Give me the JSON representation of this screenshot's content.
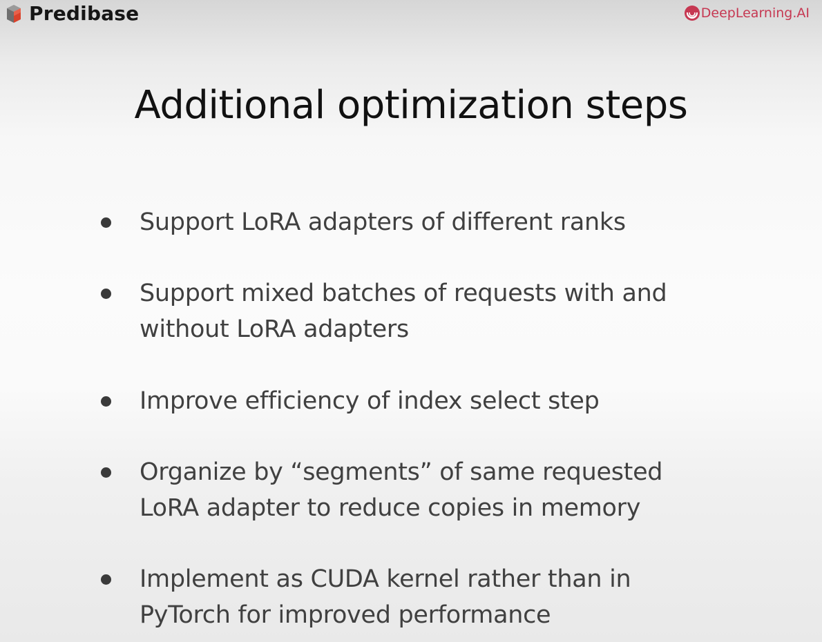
{
  "header": {
    "left_brand": "Predibase",
    "right_brand": "DeepLearning.AI",
    "left_logo_icon": "predibase-logo-icon",
    "right_logo_icon": "deeplearning-ai-logo-icon",
    "brand_colors": {
      "predibase_red": "#d9422b",
      "predibase_gray": "#7a7a7a",
      "deeplearning_red": "#c63852"
    }
  },
  "slide": {
    "title": "Additional optimization steps",
    "bullets": [
      "Support LoRA adapters of different ranks",
      "Support mixed batches of requests with and\nwithout LoRA adapters",
      "Improve efficiency of index select step",
      "Organize by “segments” of same requested\nLoRA adapter to reduce copies in memory",
      "Implement as CUDA kernel rather than in\nPyTorch for improved performance"
    ]
  }
}
